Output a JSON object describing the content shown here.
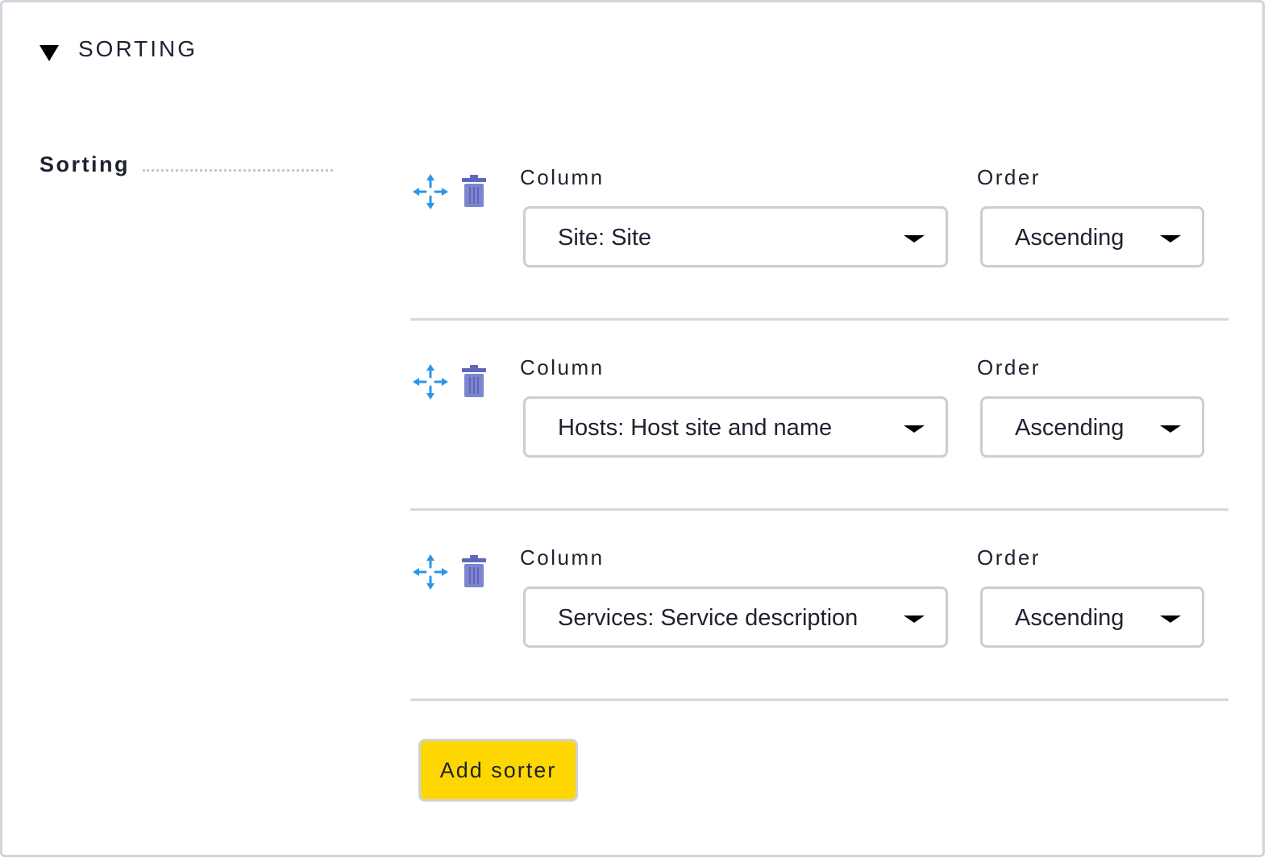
{
  "section": {
    "title": "SORTING"
  },
  "field": {
    "label": "Sorting"
  },
  "sorters": [
    {
      "column_label": "Column",
      "column_value": "Site: Site",
      "order_label": "Order",
      "order_value": "Ascending"
    },
    {
      "column_label": "Column",
      "column_value": "Hosts: Host site and name",
      "order_label": "Order",
      "order_value": "Ascending"
    },
    {
      "column_label": "Column",
      "column_value": "Services: Service description",
      "order_label": "Order",
      "order_value": "Ascending"
    }
  ],
  "actions": {
    "add_label": "Add sorter"
  },
  "colors": {
    "accent_button": "#ffd700",
    "move_icon": "#2b95e8",
    "trash_icon": "#7e85cf"
  },
  "icons": {
    "collapse": "triangle-down-icon",
    "move": "move-icon",
    "delete": "trash-icon",
    "dropdown": "chevron-down-icon"
  }
}
